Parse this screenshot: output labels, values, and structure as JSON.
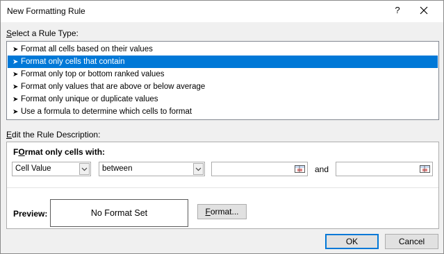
{
  "window": {
    "title": "New Formatting Rule",
    "help_label": "?",
    "close_label": "✕"
  },
  "rule_type": {
    "label_accel": "S",
    "label_rest": "elect a Rule Type:",
    "items": [
      {
        "label": "Format all cells based on their values",
        "selected": false
      },
      {
        "label": "Format only cells that contain",
        "selected": true
      },
      {
        "label": "Format only top or bottom ranked values",
        "selected": false
      },
      {
        "label": "Format only values that are above or below average",
        "selected": false
      },
      {
        "label": "Format only unique or duplicate values",
        "selected": false
      },
      {
        "label": "Use a formula to determine which cells to format",
        "selected": false
      }
    ],
    "item_glyph": "▸"
  },
  "description": {
    "label_accel": "E",
    "label_rest": "dit the Rule Description:",
    "format_only_accel": "O",
    "format_only_prefix": "F",
    "format_only_rest": "rmat only cells with:",
    "condition_type": "Cell Value",
    "operator": "between",
    "value1": "",
    "value2": "",
    "and_label": "and",
    "preview_label": "Preview:",
    "preview_text": "No Format Set",
    "format_button_accel": "F",
    "format_button_rest": "ormat..."
  },
  "buttons": {
    "ok": "OK",
    "cancel": "Cancel"
  },
  "colors": {
    "selection": "#0078d7",
    "dialog_bg": "#f0f0f0"
  }
}
